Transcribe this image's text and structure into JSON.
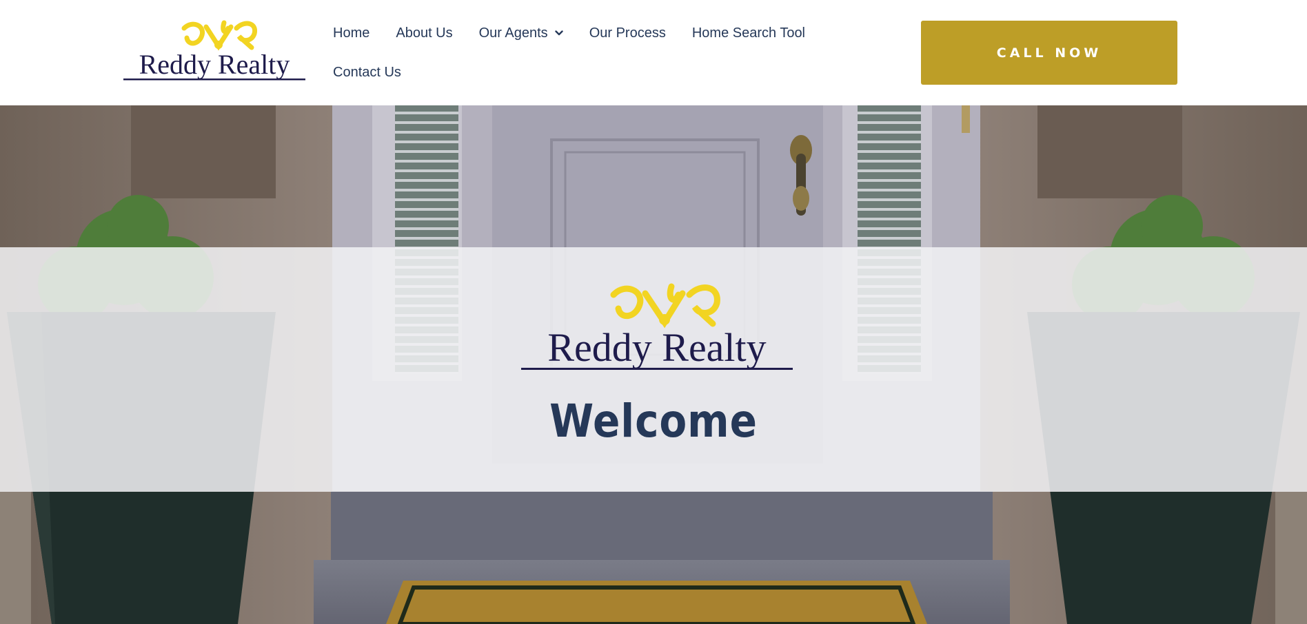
{
  "header": {
    "logo_text": "Reddy Realty",
    "nav": [
      {
        "label": "Home"
      },
      {
        "label": "About Us"
      },
      {
        "label": "Our Agents",
        "has_dropdown": true
      },
      {
        "label": "Our Process"
      },
      {
        "label": "Home Search Tool"
      },
      {
        "label": "Contact Us"
      }
    ],
    "cta_label": "CALL NOW"
  },
  "hero": {
    "logo_text": "Reddy Realty",
    "welcome": "Welcome",
    "background": "front-door-photo"
  },
  "colors": {
    "navy": "#253858",
    "gold": "#BD9E27",
    "logo_yellow": "#F2D422",
    "logo_navy": "#1E1B4B"
  },
  "icons": {
    "dropdown": "chevron-down-icon"
  }
}
